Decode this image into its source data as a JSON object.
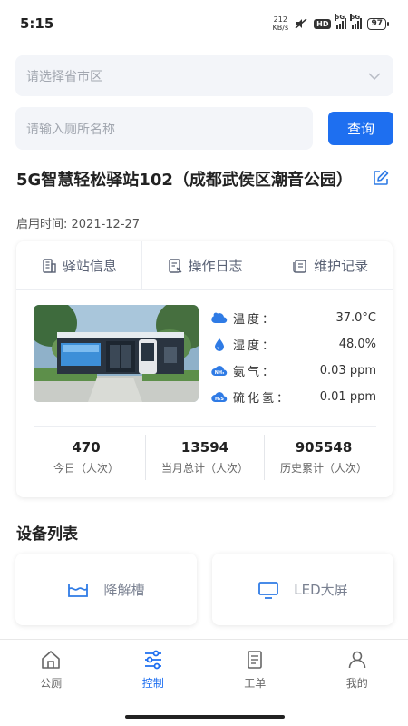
{
  "status_bar": {
    "time": "5:15",
    "net_speed_value": "212",
    "net_speed_unit": "KB/s",
    "hd_badge": "HD",
    "signal_label_1": "5G",
    "signal_label_2": "5G",
    "battery": "97"
  },
  "filters": {
    "region_placeholder": "请选择省市区",
    "search_placeholder": "请输入厕所名称",
    "search_button": "查询"
  },
  "station": {
    "title": "5G智慧轻松驿站102（成都武侯区潮音公园）",
    "start_date": "启用时间: 2021-12-27"
  },
  "tabs": [
    {
      "label": "驿站信息"
    },
    {
      "label": "操作日志"
    },
    {
      "label": "维护记录"
    }
  ],
  "sensors": [
    {
      "label": "温度：",
      "value": "37.0°C",
      "icon": "temperature-icon"
    },
    {
      "label": "湿度：",
      "value": "48.0%",
      "icon": "humidity-icon"
    },
    {
      "label": "氨气：",
      "value": "0.03 ppm",
      "icon": "ammonia-icon"
    },
    {
      "label": "硫化氢：",
      "value": "0.01 ppm",
      "icon": "hydrogen-sulfide-icon"
    }
  ],
  "sensor_icon_text": {
    "ammonia": "NH₃",
    "h2s": "H₂S"
  },
  "stats": [
    {
      "value": "470",
      "label": "今日（人次）"
    },
    {
      "value": "13594",
      "label": "当月总计（人次）"
    },
    {
      "value": "905548",
      "label": "历史累计（人次）"
    }
  ],
  "devices": {
    "section_title": "设备列表",
    "items": [
      {
        "label": "降解槽",
        "icon": "degradation-tank-icon"
      },
      {
        "label": "LED大屏",
        "icon": "monitor-icon"
      }
    ]
  },
  "nav": [
    {
      "label": "公厕",
      "icon": "home-icon",
      "active": false
    },
    {
      "label": "控制",
      "icon": "control-icon",
      "active": true
    },
    {
      "label": "工单",
      "icon": "work-order-icon",
      "active": false
    },
    {
      "label": "我的",
      "icon": "user-icon",
      "active": false
    }
  ],
  "colors": {
    "accent": "#1e6ff0",
    "input_bg": "#f3f5f9",
    "icon_blue": "#2f7be5"
  }
}
